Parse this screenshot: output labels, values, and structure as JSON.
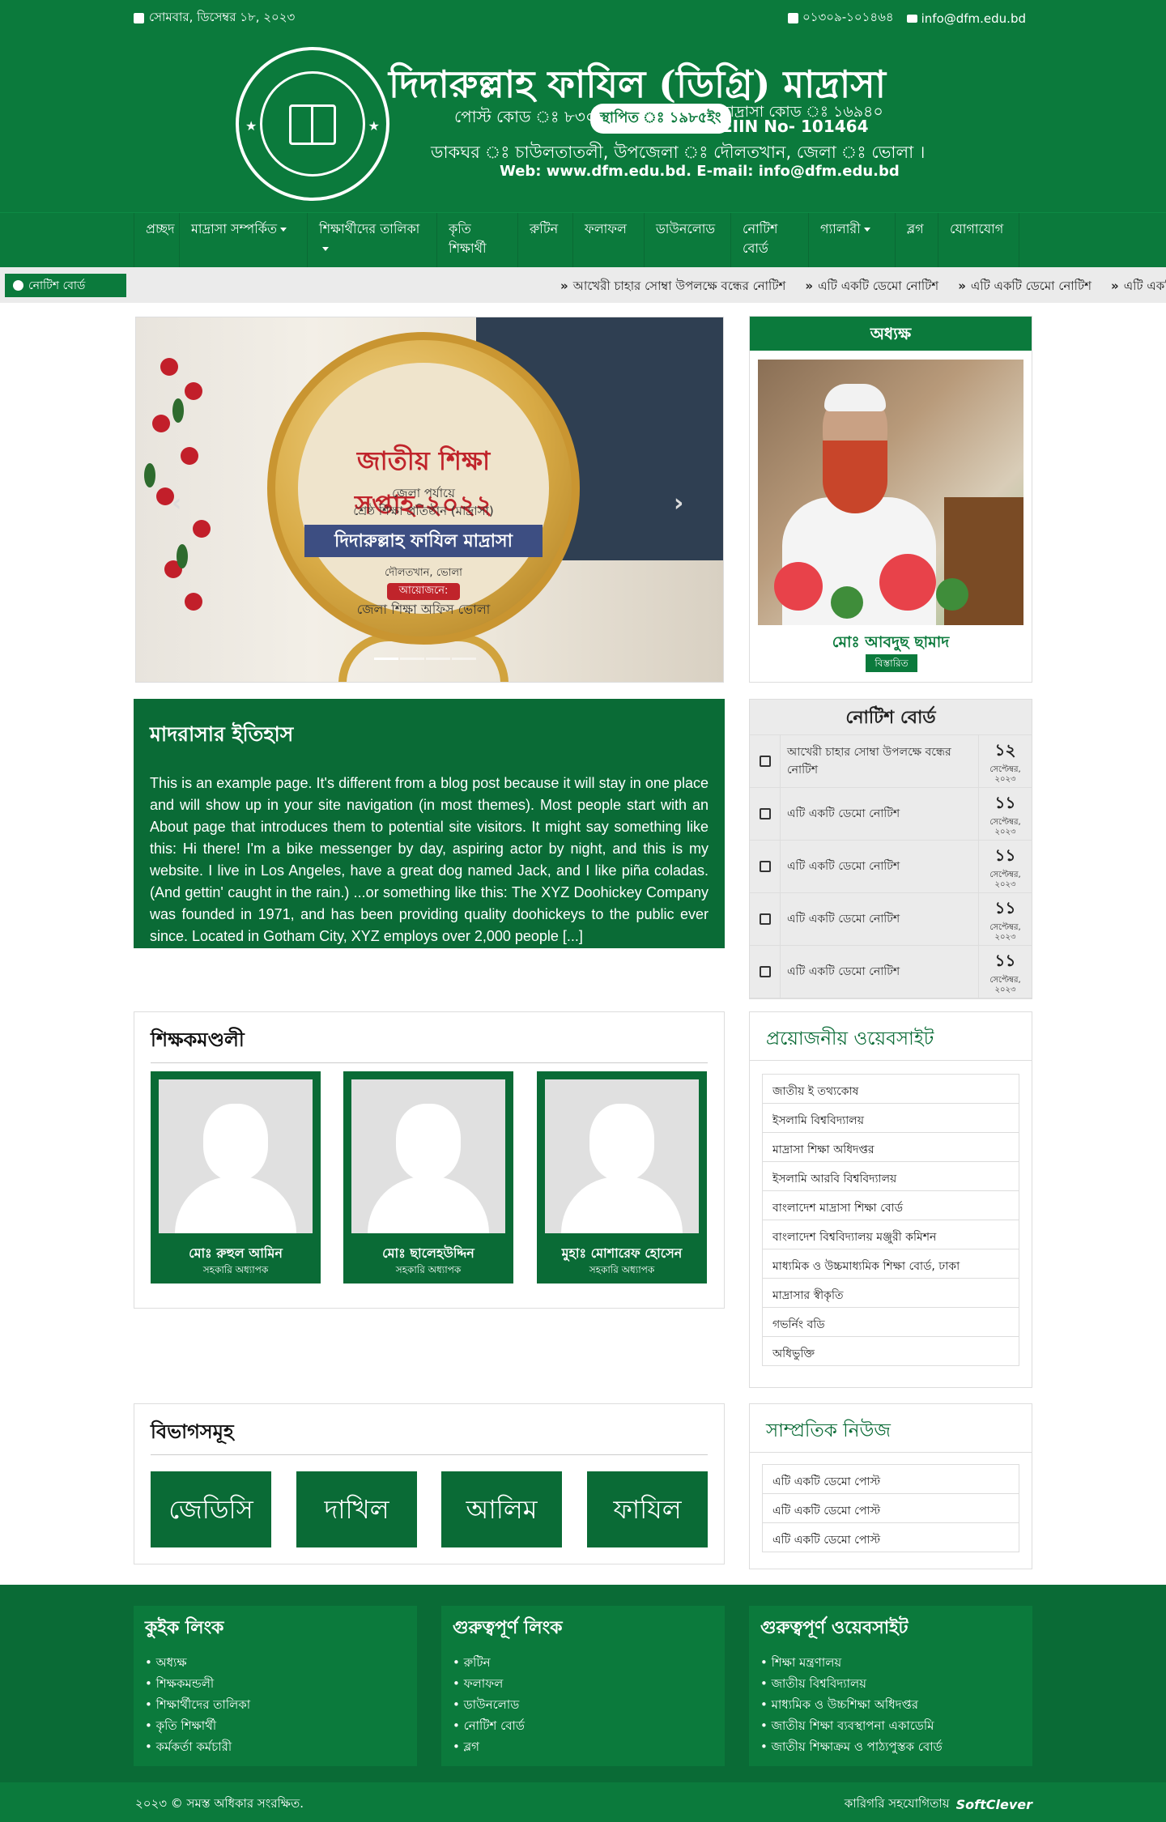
{
  "topbar": {
    "date": "সোমবার, ডিসেম্বর ১৮, ২০২৩",
    "phone": "০১৩০৯-১০১৪৬৪",
    "email": "info@dfm.edu.bd"
  },
  "header": {
    "logo_text_top": "দিদারুল্লাহ ফাযিল ডিগ্রি মাদ্রাসা",
    "logo_text_bottom": "দৌলতখান, ভোলা।",
    "title": "দিদারুল্লাহ ফাযিল (ডিগ্রি) মাদ্রাসা",
    "post_code": "পোস্ট কোড ঃ ৮৩০১",
    "established": "স্থাপিত ঃ ১৯৮৫ইং",
    "madrasa_code": "মাদ্রাসা কোড ঃ ১৬৯৪০",
    "eiin": "EIIN No- 101464",
    "address": "ডাকঘর ঃ চাউলতাতলী, উপজেলা ঃ দৌলতখান, জেলা ঃ ভোলা ।",
    "web": "Web: www.dfm.edu.bd. E-mail: info@dfm.edu.bd"
  },
  "nav": {
    "items": [
      {
        "label": "প্রচ্ছদ",
        "dropdown": false
      },
      {
        "label": "মাদ্রাসা সম্পর্কিত",
        "dropdown": true
      },
      {
        "label": "শিক্ষার্থীদের তালিকা",
        "dropdown": true
      },
      {
        "label": "কৃতি শিক্ষার্থী",
        "dropdown": false
      },
      {
        "label": "রুটিন",
        "dropdown": false
      },
      {
        "label": "ফলাফল",
        "dropdown": false
      },
      {
        "label": "ডাউনলোড",
        "dropdown": false
      },
      {
        "label": "নোটিশ বোর্ড",
        "dropdown": false
      },
      {
        "label": "গ্যালারী",
        "dropdown": true
      },
      {
        "label": "ব্লগ",
        "dropdown": false
      },
      {
        "label": "যোগাযোগ",
        "dropdown": false
      }
    ]
  },
  "ticker": {
    "label": "নোটিশ বোর্ড",
    "items": [
      "আখেরী চাহার সোম্বা উপলক্ষে বন্ধের নোটিশ",
      "এটি একটি ডেমো নোটিশ",
      "এটি একটি ডেমো নোটিশ",
      "এটি একটি"
    ]
  },
  "slider": {
    "plaque_title": "জাতীয় শিক্ষা সপ্তাহ-২০২২",
    "plaque_line1": "জেলা পর্যায়ে",
    "plaque_line2": "শ্রেষ্ঠ শিক্ষা প্রতিষ্ঠান (মাদ্রাসা)",
    "plaque_banner": "দিদারুল্লাহ ফাযিল মাদ্রাসা",
    "plaque_place": "দৌলতখান, ভোলা",
    "plaque_organizer": "আয়োজনে:",
    "plaque_office": "জেলা শিক্ষা অফিস ভোলা",
    "prev": "‹",
    "next": "›",
    "active_slide": 1,
    "slide_count": 4
  },
  "principal": {
    "heading": "অধ্যক্ষ",
    "name": "মোঃ আবদুছ ছামাদ",
    "details_label": "বিস্তারিত"
  },
  "history": {
    "title": "মাদরাসার ইতিহাস",
    "body": "This is an example page. It's different from a blog post because it will stay in one place and will show up in your site navigation (in most themes). Most people start with an About page that introduces them to potential site visitors. It might say something like this: Hi there! I'm a bike messenger by day, aspiring actor by night, and this is my website. I live in Los Angeles, have a great dog named Jack, and I like piña coladas. (And gettin' caught in the rain.) ...or something like this: The XYZ Doohickey Company was founded in 1971, and has been providing quality doohickeys to the public ever since. Located in Gotham City, XYZ employs over 2,000 people [...]"
  },
  "notice_board": {
    "heading": "নোটিশ বোর্ড",
    "items": [
      {
        "title": "আখেরী চাহার সোম্বা উপলক্ষে বন্ধের নোটিশ",
        "day": "১২",
        "month": "সেপ্টেম্বর, ২০২৩"
      },
      {
        "title": "এটি একটি ডেমো নোটিশ",
        "day": "১১",
        "month": "সেপ্টেম্বর, ২০২৩"
      },
      {
        "title": "এটি একটি ডেমো নোটিশ",
        "day": "১১",
        "month": "সেপ্টেম্বর, ২০২৩"
      },
      {
        "title": "এটি একটি ডেমো নোটিশ",
        "day": "১১",
        "month": "সেপ্টেম্বর, ২০২৩"
      },
      {
        "title": "এটি একটি ডেমো নোটিশ",
        "day": "১১",
        "month": "সেপ্টেম্বর, ২০২৩"
      }
    ]
  },
  "teachers": {
    "heading": "শিক্ষকমণ্ডলী",
    "items": [
      {
        "name": "মোঃ রুহুল আমিন",
        "designation": "সহকারি অধ্যাপক"
      },
      {
        "name": "মোঃ ছালেহউদ্দিন",
        "designation": "সহকারি অধ্যাপক"
      },
      {
        "name": "মুহাঃ মোশারেফ হোসেন",
        "designation": "সহকারি অধ্যাপক"
      }
    ]
  },
  "websites": {
    "heading": "প্রয়োজনীয় ওয়েবসাইট",
    "items": [
      "জাতীয় ই তথ্যকোষ",
      "ইসলামি বিশ্ববিদ্যালয়",
      "মাদ্রাসা শিক্ষা অধিদপ্তর",
      "ইসলামি আরবি বিশ্ববিদ্যালয়",
      "বাংলাদেশ মাদ্রাসা শিক্ষা বোর্ড",
      "বাংলাদেশ বিশ্ববিদ্যালয় মঞ্জুরী কমিশন",
      "মাধ্যমিক ও উচ্চমাধ্যমিক শিক্ষা বোর্ড, ঢাকা",
      "মাদ্রাসার স্বীকৃতি",
      "গভর্নিং বডি",
      "অধিভুক্তি"
    ]
  },
  "departments": {
    "heading": "বিভাগসমূহ",
    "items": [
      "জেডিসি",
      "দাখিল",
      "আলিম",
      "ফাযিল"
    ]
  },
  "news": {
    "heading": "সাম্প্রতিক নিউজ",
    "items": [
      "এটি একটি ডেমো পোস্ট",
      "এটি একটি ডেমো পোস্ট",
      "এটি একটি ডেমো পোস্ট"
    ]
  },
  "footer": {
    "quick": {
      "heading": "কুইক লিংক",
      "items": [
        "অধ্যক্ষ",
        "শিক্ষকমন্ডলী",
        "শিক্ষার্থীদের তালিকা",
        "কৃতি শিক্ষার্থী",
        "কর্মকর্তা কর্মচারী"
      ]
    },
    "important": {
      "heading": "গুরুত্বপূর্ণ লিংক",
      "items": [
        "রুটিন",
        "ফলাফল",
        "ডাউনলোড",
        "নোটিশ বোর্ড",
        "ব্লগ"
      ]
    },
    "sites": {
      "heading": "গুরুত্বপূর্ণ ওয়েবসাইট",
      "items": [
        "শিক্ষা মন্ত্রণালয়",
        "জাতীয় বিশ্ববিদ্যালয়",
        "মাধ্যমিক ও উচ্চশিক্ষা অধিদপ্তর",
        "জাতীয় শিক্ষা ব্যবস্থাপনা একাডেমি",
        "জাতীয় শিক্ষাক্রম ও পাঠ্যপুস্তক বোর্ড"
      ]
    },
    "copyright": "২০২৩ © সমস্ত অধিকার সংরক্ষিত.",
    "credit": "কারিগরি সহযোগিতায়",
    "brand": "SoftClever"
  }
}
